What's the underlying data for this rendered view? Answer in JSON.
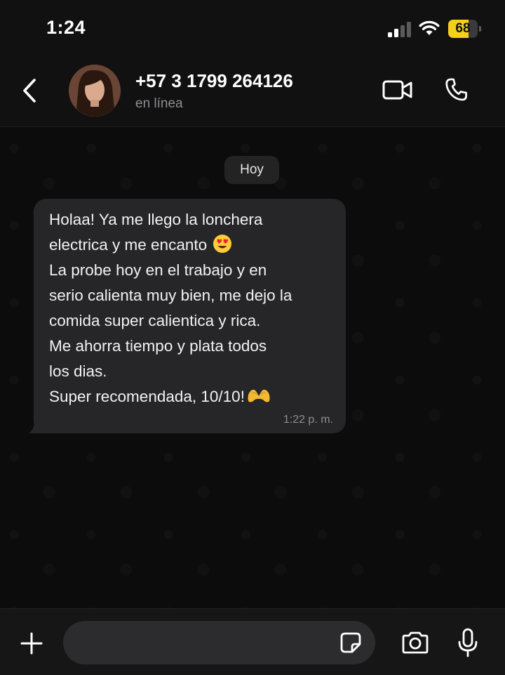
{
  "status_bar": {
    "time": "1:24",
    "battery_level": 68,
    "battery_text": "68",
    "battery_color": "#f5cf1c"
  },
  "header": {
    "contact_name": "+57 3 1799 264126",
    "status": "en línea",
    "icons": {
      "back": "chevron-left-icon",
      "video": "video-call-icon",
      "call": "phone-icon"
    }
  },
  "chat": {
    "date_chip": "Hoy",
    "messages": [
      {
        "lines": [
          "Holaa! Ya me llego la lonchera",
          "electrica y me encanto",
          "La probe hoy en el trabajo y en",
          "serio calienta muy bien, me dejo la",
          "comida super calientica y rica.",
          "Me ahorra tiempo y plata todos",
          "los dias.",
          "Super recomendada, 10/10!"
        ],
        "emojis": [
          "heart-eyes-emoji",
          "heart-hands-emoji"
        ],
        "time": "1:22 p. m.",
        "direction": "incoming"
      }
    ]
  },
  "input_bar": {
    "placeholder": "",
    "icons": {
      "attach": "plus-icon",
      "sticker": "sticker-icon",
      "camera": "camera-icon",
      "mic": "microphone-icon"
    }
  },
  "colors": {
    "background": "#0b0b0b",
    "bubble": "#262628",
    "secondary_text": "#8e8e93"
  }
}
